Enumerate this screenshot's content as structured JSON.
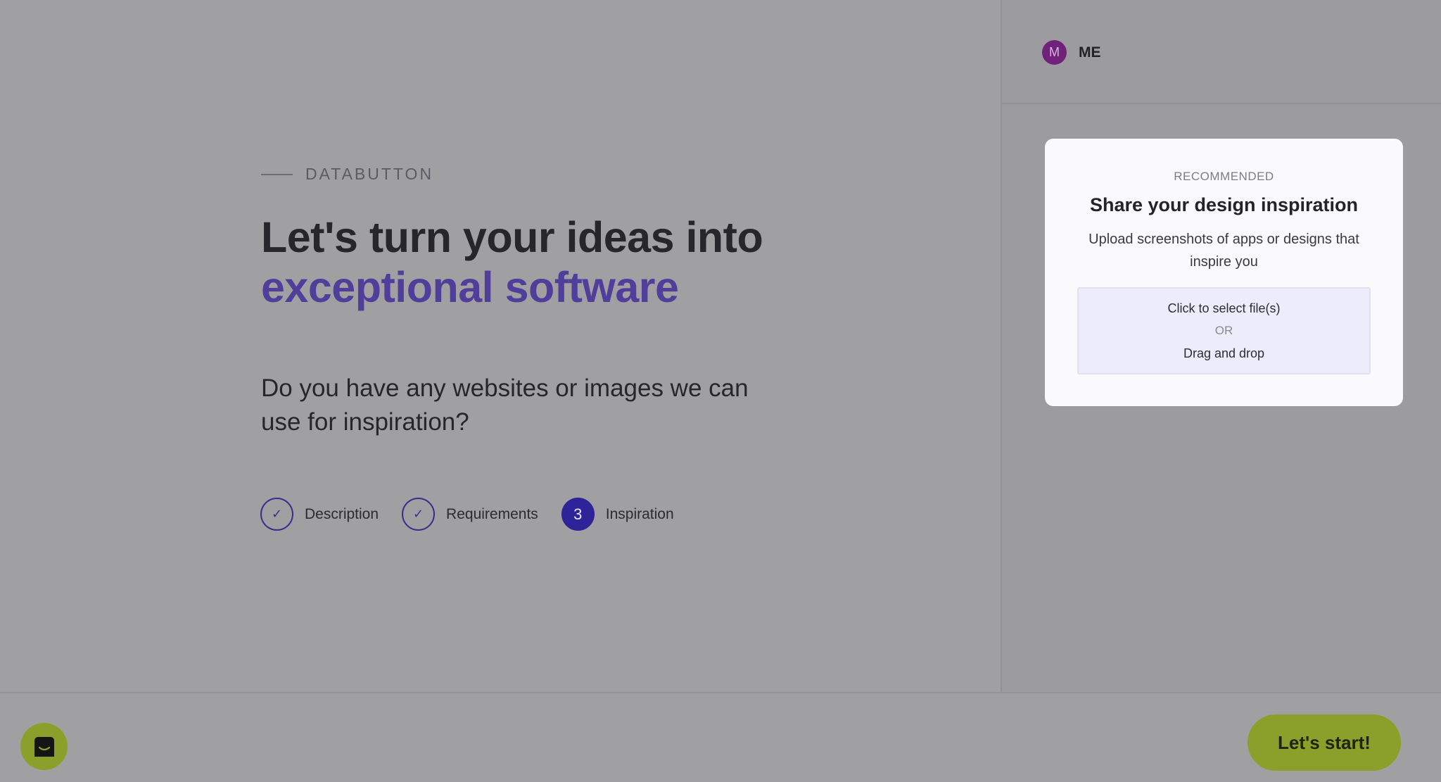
{
  "brand": {
    "name": "DATABUTTON"
  },
  "headline": {
    "line1": "Let's turn your ideas into",
    "line2": "exceptional software"
  },
  "question": "Do you have any websites or images we can use for inspiration?",
  "steps": [
    {
      "label": "Description",
      "status": "done",
      "marker": "✓"
    },
    {
      "label": "Requirements",
      "status": "done",
      "marker": "✓"
    },
    {
      "label": "Inspiration",
      "status": "active",
      "marker": "3"
    }
  ],
  "user": {
    "initial": "M",
    "name": "ME"
  },
  "upload_card": {
    "kicker": "RECOMMENDED",
    "title": "Share your design inspiration",
    "description": "Upload screenshots of apps or designs that inspire you",
    "dropzone": {
      "select_text": "Click to select file(s)",
      "or_text": "OR",
      "drag_text": "Drag and drop"
    }
  },
  "footer": {
    "chat_icon": "chat-icon",
    "start_label": "Let's start!"
  },
  "colors": {
    "accent": "#4f3f9a",
    "step_active": "#2e2399",
    "start_button": "#8aa02a",
    "avatar": "#70227a"
  }
}
